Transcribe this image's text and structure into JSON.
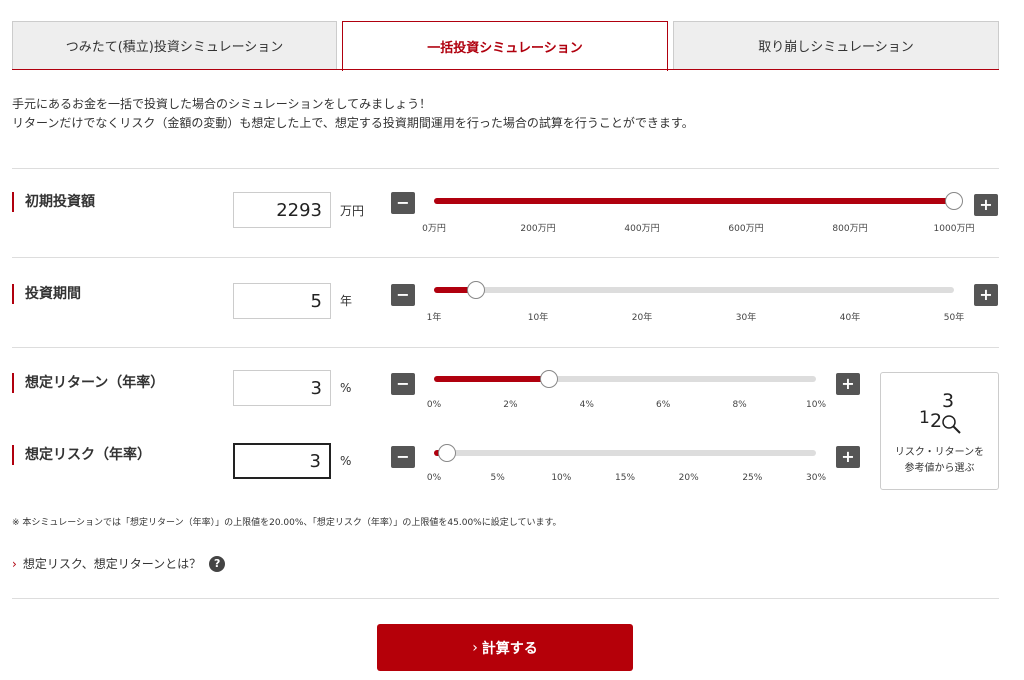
{
  "tabs": [
    {
      "label": "つみたて(積立)投資シミュレーション"
    },
    {
      "label": "一括投資シミュレーション"
    },
    {
      "label": "取り崩しシミュレーション"
    }
  ],
  "intro": {
    "line1": "手元にあるお金を一括で投資した場合のシミュレーションをしてみましょう！",
    "line2": "リターンだけでなくリスク（金額の変動）も想定した上で、想定する投資期間運用を行った場合の試算を行うことができます。"
  },
  "initial_amount": {
    "label": "初期投資額",
    "value": "2293",
    "unit": "万円",
    "slider_fraction": 1.0,
    "ticks": [
      "0万円",
      "200万円",
      "400万円",
      "600万円",
      "800万円",
      "1000万円"
    ]
  },
  "period": {
    "label": "投資期間",
    "value": "5",
    "unit": "年",
    "slider_fraction": 0.0816,
    "ticks": [
      "1年",
      "10年",
      "20年",
      "30年",
      "40年",
      "50年"
    ]
  },
  "return_rate": {
    "label": "想定リターン（年率）",
    "value": "3",
    "unit": "%",
    "slider_fraction": 0.3,
    "ticks": [
      "0%",
      "2%",
      "4%",
      "6%",
      "8%",
      "10%"
    ]
  },
  "risk_rate": {
    "label": "想定リスク（年率）",
    "value": "3",
    "unit": "%",
    "slider_fraction": 0.0333,
    "ticks": [
      "0%",
      "5%",
      "10%",
      "15%",
      "20%",
      "25%",
      "30%"
    ]
  },
  "buttons": {
    "minus": "−",
    "plus": "+"
  },
  "reference": {
    "line1": "リスク・リターンを",
    "line2": "参考値から選ぶ"
  },
  "note": "※ 本シミュレーションでは「想定リターン（年率）」の上限値を20.00%、「想定リスク（年率）」の上限値を45.00%に設定しています。",
  "help_link": {
    "label": "想定リスク、想定リターンとは？",
    "icon": "?"
  },
  "calc_button": {
    "label": "計算する"
  },
  "colors": {
    "accent": "#b0000e",
    "button": "#b50009"
  }
}
